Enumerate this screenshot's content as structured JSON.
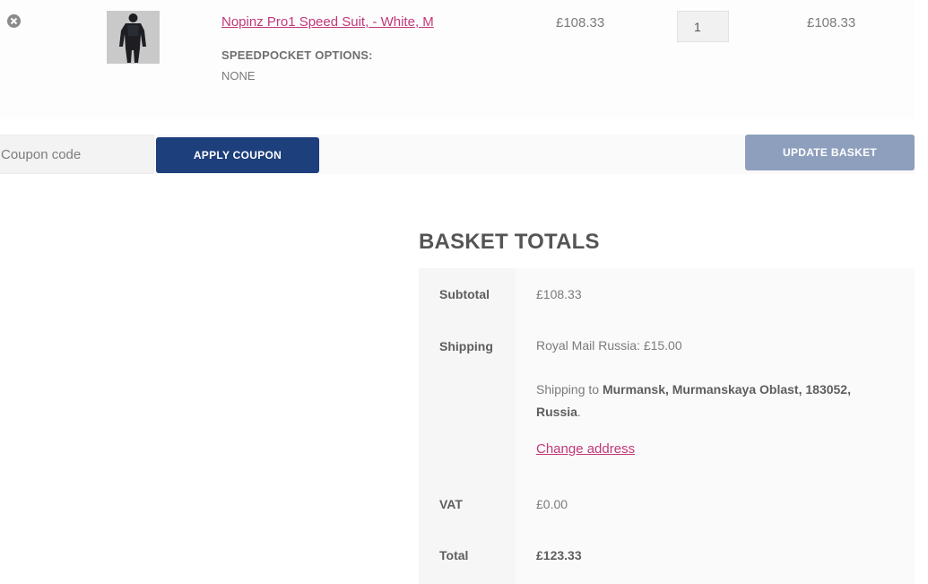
{
  "cart": {
    "item": {
      "name": "Nopinz Pro1 Speed Suit, - White, M",
      "variation_label": "SPEEDPOCKET OPTIONS:",
      "variation_value": "NONE",
      "price": "£108.33",
      "quantity": "1",
      "line_total": "£108.33"
    }
  },
  "actions": {
    "coupon_placeholder": "Coupon code",
    "apply_coupon_label": "APPLY COUPON",
    "update_basket_label": "UPDATE BASKET"
  },
  "totals": {
    "heading": "BASKET TOTALS",
    "subtotal_label": "Subtotal",
    "subtotal_value": "£108.33",
    "shipping_label": "Shipping",
    "shipping_method": "Royal Mail Russia: £15.00",
    "shipping_to_prefix": "Shipping to",
    "shipping_destination": "Murmansk, Murmanskaya Oblast, 183052, Russia",
    "change_address_label": "Change address",
    "vat_label": "VAT",
    "vat_value": "£0.00",
    "total_label": "Total",
    "total_value": "£123.33"
  }
}
